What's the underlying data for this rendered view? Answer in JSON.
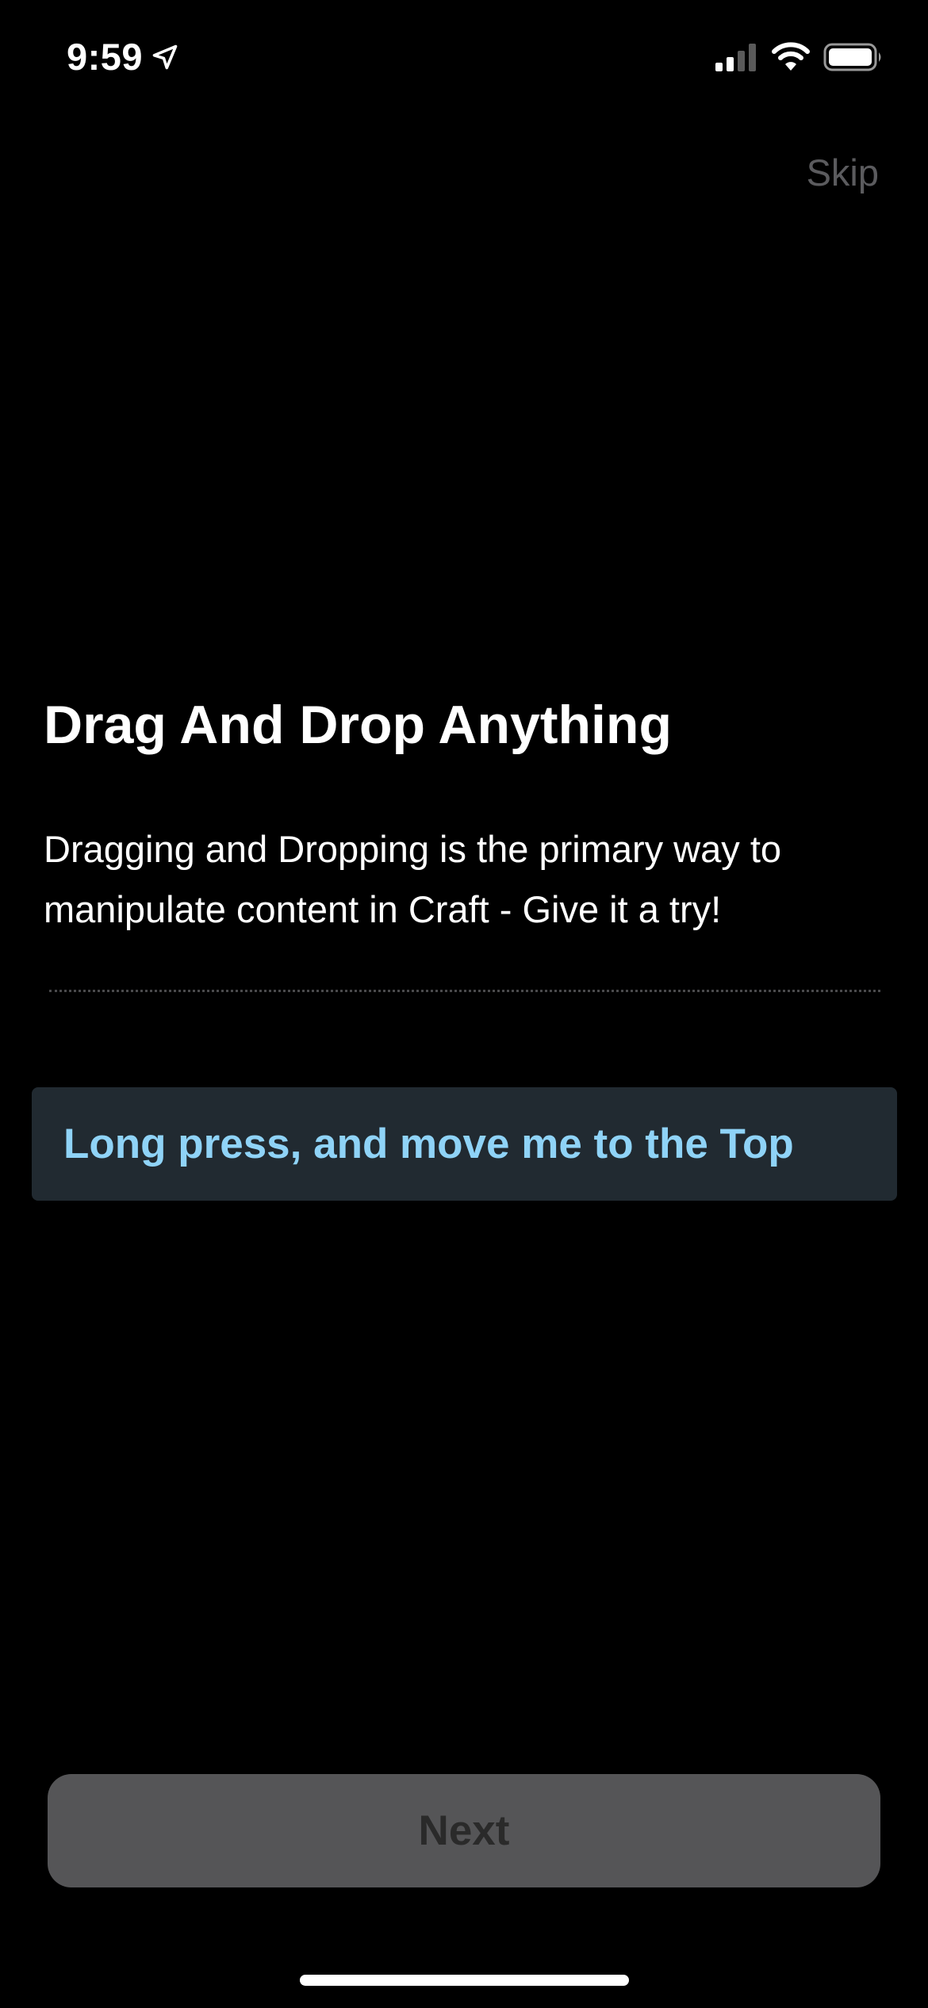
{
  "status_bar": {
    "time": "9:59",
    "location_icon": "location-arrow-icon",
    "signal_icon": "cellular-signal-icon",
    "wifi_icon": "wifi-icon",
    "battery_icon": "battery-icon"
  },
  "header": {
    "skip_label": "Skip"
  },
  "main": {
    "title": "Drag And Drop Anything",
    "description": "Dragging and Dropping is the primary way to manipulate content in Craft - Give it a try!",
    "drag_card_label": "Long press, and move me to the Top"
  },
  "footer": {
    "next_label": "Next"
  },
  "colors": {
    "background": "#000000",
    "card_background": "#212a31",
    "card_text": "#8fd3f7",
    "button_background": "#555557",
    "skip_text": "#5b5b5e"
  }
}
